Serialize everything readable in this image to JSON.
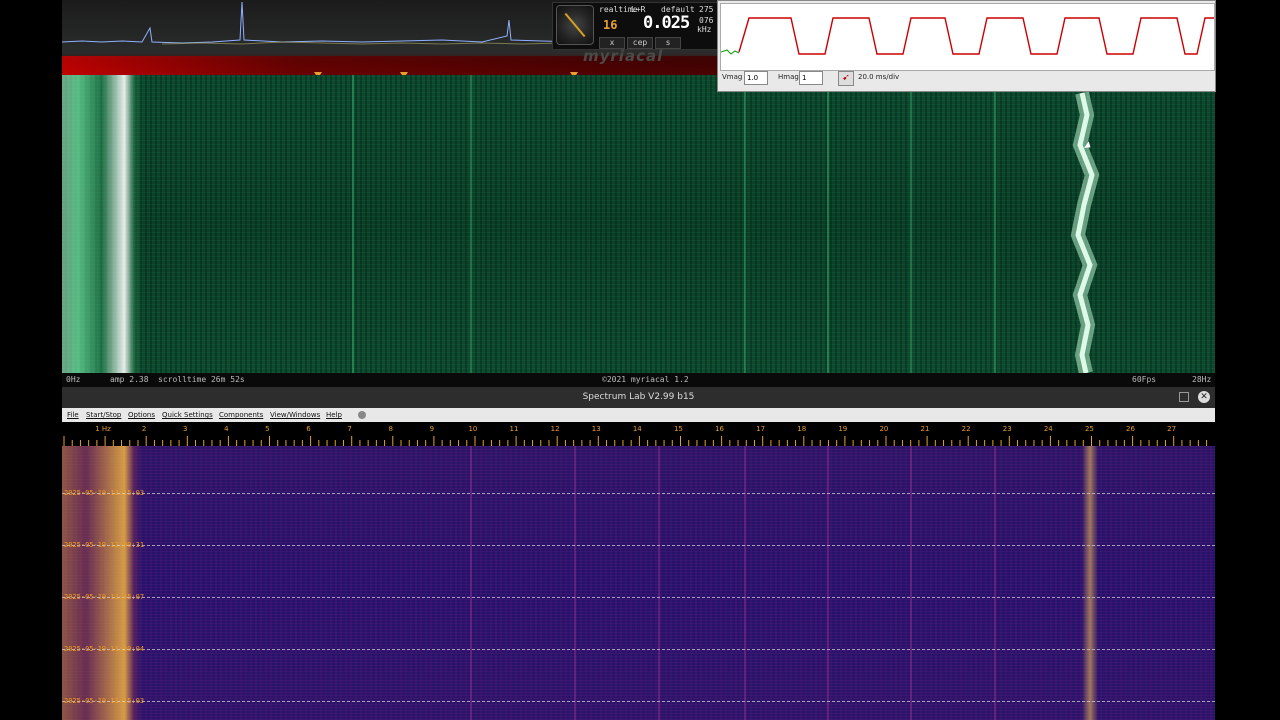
{
  "top_app": {
    "meter": {
      "mode": "realtime",
      "channel": "L+R",
      "preset": "default",
      "value": "0.025",
      "left_value": "16",
      "right_top": "275",
      "right_mid": "076",
      "unit": "kHz",
      "buttons": [
        "x",
        "cep",
        "s"
      ]
    },
    "brand": "myriacal",
    "status": {
      "freq_left": "0Hz",
      "amp": "amp 2.38",
      "scrolltime": "scrolltime 26m 52s",
      "copyright": "©2021 myriacal 1.2",
      "fps": "60Fps",
      "freq_right": "28Hz"
    },
    "colors": {
      "waterfall": "#0b3f28",
      "trace": "#ffffff",
      "marker": "#e8a030"
    }
  },
  "scope": {
    "vmag_label": "Vmag",
    "vmag_value": "1.0",
    "hmag_label": "Hmag",
    "hmag_value": "1",
    "timebase": "20.0 ms/div",
    "trace_color": "#cc0000"
  },
  "spectrum_lab": {
    "title": "Spectrum Lab V2.99 b15",
    "menu": [
      "File",
      "Start/Stop",
      "Options",
      "Quick Settings",
      "Components",
      "View/Windows",
      "Help"
    ],
    "scale_labels": [
      "1 Hz",
      "2",
      "3",
      "4",
      "5",
      "6",
      "7",
      "8",
      "9",
      "10",
      "11",
      "12",
      "13",
      "14",
      "15",
      "16",
      "17",
      "18",
      "19",
      "20",
      "21",
      "22",
      "23",
      "24",
      "25",
      "26",
      "27"
    ],
    "timestamps": [
      "2025-05-19 12:15:03",
      "2025-05-19 12:00:31",
      "2025-05-19 11:45:07",
      "2025-05-19 11:30:04",
      "2025-05-19 11:15:03"
    ],
    "colors": {
      "waterfall": "#24126a",
      "label": "#f0a020"
    }
  }
}
